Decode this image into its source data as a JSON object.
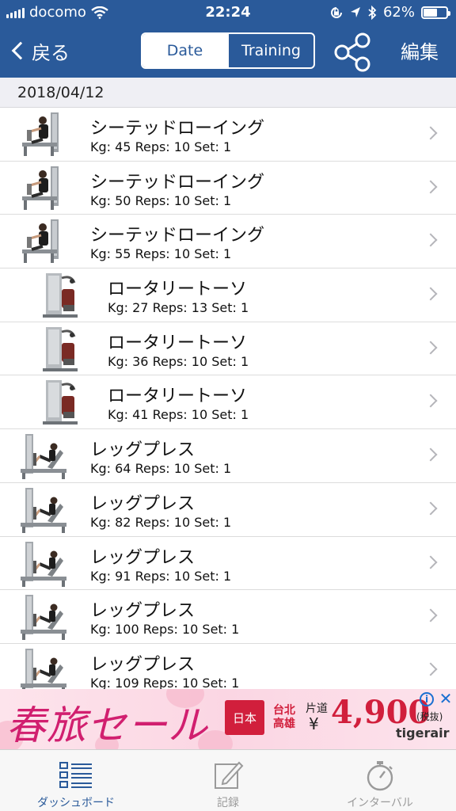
{
  "status_bar": {
    "carrier": "docomo",
    "time": "22:24",
    "battery_percent": "62%",
    "battery_level": 0.62,
    "icons": [
      "signal-icon",
      "wifi-icon",
      "orientation-lock-icon",
      "location-icon",
      "bluetooth-icon",
      "battery-icon"
    ]
  },
  "nav": {
    "back_label": "戻る",
    "segments": [
      "Date",
      "Training"
    ],
    "selected_segment": "Date",
    "share_icon": "share-icon",
    "edit_label": "編集"
  },
  "colors": {
    "nav_background": "#2a5a9a",
    "section_background": "#efeff4",
    "ad_accent": "#d11f6f",
    "tab_active": "#2a5a9a"
  },
  "section": {
    "date": "2018/04/12"
  },
  "workouts": [
    {
      "name": "シーテッドローイング",
      "detail": "Kg: 45 Reps: 10 Set: 1",
      "machine": "seated-row"
    },
    {
      "name": "シーテッドローイング",
      "detail": "Kg: 50 Reps: 10 Set: 1",
      "machine": "seated-row"
    },
    {
      "name": "シーテッドローイング",
      "detail": "Kg: 55 Reps: 10 Set: 1",
      "machine": "seated-row"
    },
    {
      "name": "ロータリートーソ",
      "detail": "Kg: 27 Reps: 13 Set: 1",
      "machine": "rotary-torso"
    },
    {
      "name": "ロータリートーソ",
      "detail": "Kg: 36 Reps: 10 Set: 1",
      "machine": "rotary-torso"
    },
    {
      "name": "ロータリートーソ",
      "detail": "Kg: 41 Reps: 10 Set: 1",
      "machine": "rotary-torso"
    },
    {
      "name": "レッグプレス",
      "detail": "Kg: 64 Reps: 10 Set: 1",
      "machine": "leg-press"
    },
    {
      "name": "レッグプレス",
      "detail": "Kg: 82 Reps: 10 Set: 1",
      "machine": "leg-press"
    },
    {
      "name": "レッグプレス",
      "detail": "Kg: 91 Reps: 10 Set: 1",
      "machine": "leg-press"
    },
    {
      "name": "レッグプレス",
      "detail": "Kg: 100 Reps: 10 Set: 1",
      "machine": "leg-press"
    },
    {
      "name": "レッグプレス",
      "detail": "Kg: 109 Reps: 10 Set: 1",
      "machine": "leg-press"
    }
  ],
  "ad": {
    "title": "春旅セール",
    "route_from": "日本",
    "route_to_line1": "台北",
    "route_to_line2": "高雄",
    "one_way": "片道",
    "yen_symbol": "¥",
    "price": "4,900",
    "tax_note": "(税抜)",
    "brand": "tigerair",
    "info_icon": "info-icon",
    "close_icon": "close-icon"
  },
  "tabs": [
    {
      "label": "ダッシュボード",
      "icon": "dashboard-icon",
      "active": true
    },
    {
      "label": "記録",
      "icon": "edit-record-icon",
      "active": false
    },
    {
      "label": "インターバル",
      "icon": "stopwatch-icon",
      "active": false
    }
  ]
}
